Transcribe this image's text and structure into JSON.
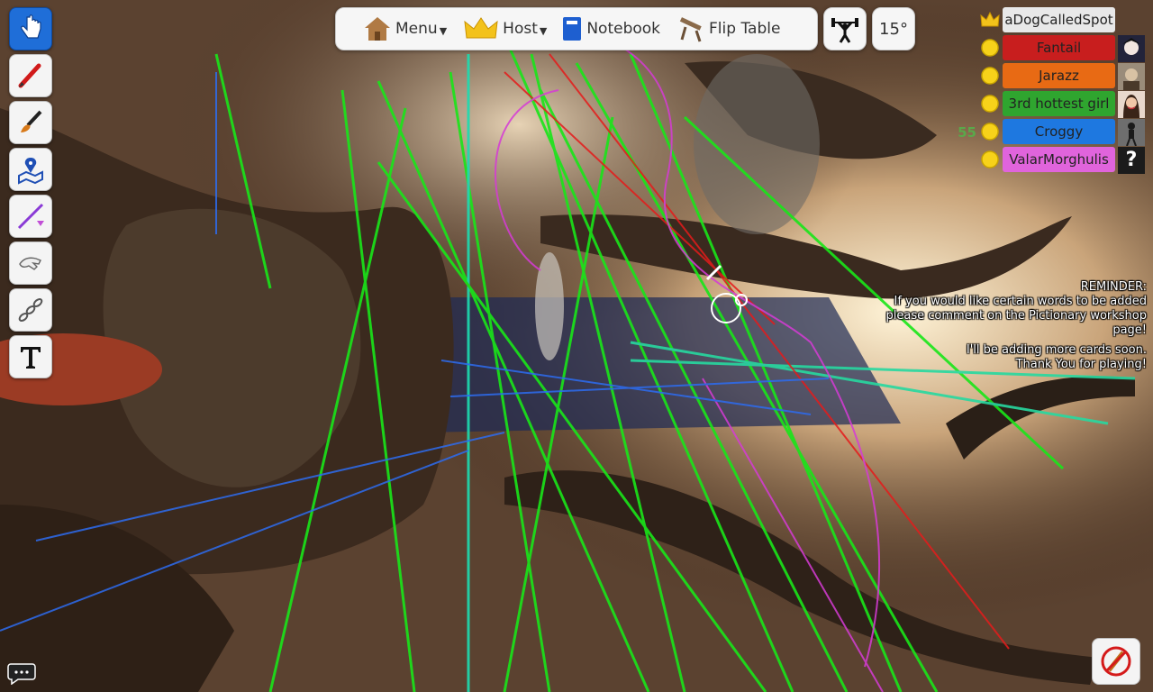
{
  "topbar": {
    "menu_label": "Menu",
    "host_label": "Host",
    "notebook_label": "Notebook",
    "flip_table_label": "Flip Table",
    "rotation_angle": "15°"
  },
  "toolbar": {
    "tools": [
      "pointer",
      "pen",
      "paint-brush",
      "map-ping",
      "line",
      "gizmo-hand",
      "joint-chain",
      "text"
    ],
    "active_tool": "pointer"
  },
  "players": [
    {
      "name": "aDogCalledSpot",
      "color": "#e8e8e8",
      "score": "",
      "badge": "crown",
      "avatar": "none"
    },
    {
      "name": "Fantail",
      "color": "#c81e1e",
      "score": "",
      "badge": "coin",
      "avatar": "anime"
    },
    {
      "name": "Jarazz",
      "color": "#e86a14",
      "score": "",
      "badge": "coin",
      "avatar": "portrait"
    },
    {
      "name": "3rd hottest girl",
      "color": "#2fa52f",
      "score": "",
      "badge": "coin",
      "avatar": "photo"
    },
    {
      "name": "Croggy",
      "color": "#1e78e0",
      "score": "55",
      "badge": "coin",
      "avatar": "figure"
    },
    {
      "name": "ValarMorghulis",
      "color": "#e064dc",
      "score": "",
      "badge": "coin",
      "avatar": "unknown"
    }
  ],
  "unknown_avatar_text": "?",
  "reminder": {
    "lines": [
      "REMINDER:",
      "If you would like certain words to be added",
      "please comment on the Pictionary workshop",
      "page!",
      "",
      "I'll be adding more cards soon.",
      "Thank You for playing!"
    ]
  }
}
